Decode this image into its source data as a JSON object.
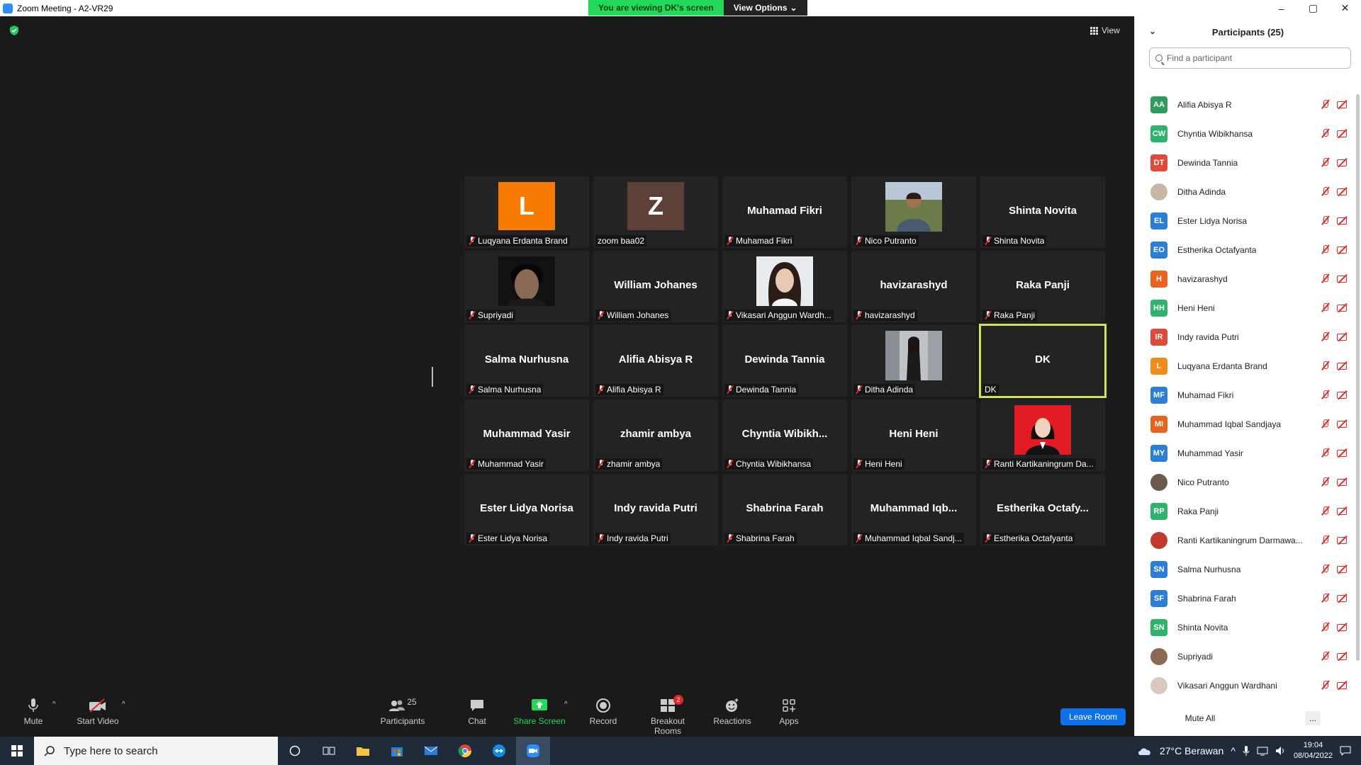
{
  "window": {
    "title": "Zoom Meeting - A2-VR29",
    "controls": [
      "–",
      "▢",
      "✕"
    ]
  },
  "banner": {
    "viewing": "You are viewing DK's screen",
    "view_options": "View Options"
  },
  "stage": {
    "view_label": "View"
  },
  "tiles": [
    {
      "big": "",
      "avatar_letter": "L",
      "avatar_color": "#f57c00",
      "label": "Luqyana Erdanta Brand",
      "muted": true
    },
    {
      "big": "",
      "avatar_letter": "Z",
      "avatar_color": "#5d4037",
      "label": "zoom baa02",
      "muted": false
    },
    {
      "big": "Muhamad Fikri",
      "label": "Muhamad Fikri",
      "muted": true
    },
    {
      "big": "",
      "photo": "man-in-shirt",
      "label": "Nico Putranto",
      "muted": true
    },
    {
      "big": "Shinta Novita",
      "label": "Shinta Novita",
      "muted": true
    },
    {
      "big": "",
      "photo": "man-portrait",
      "label": "Supriyadi",
      "muted": true
    },
    {
      "big": "William Johanes",
      "label": "William Johanes",
      "muted": true
    },
    {
      "big": "",
      "photo": "woman-selfie",
      "label": "Vikasari Anggun Wardh...",
      "muted": true
    },
    {
      "big": "havizarashyd",
      "label": "havizarashyd",
      "muted": true
    },
    {
      "big": "Raka Panji",
      "label": "Raka Panji",
      "muted": true
    },
    {
      "big": "Salma Nurhusna",
      "label": "Salma Nurhusna",
      "muted": true
    },
    {
      "big": "Alifia Abisya R",
      "label": "Alifia Abisya R",
      "muted": true
    },
    {
      "big": "Dewinda Tannia",
      "label": "Dewinda Tannia",
      "muted": true
    },
    {
      "big": "",
      "photo": "woman-standing",
      "label": "Ditha Adinda",
      "muted": true
    },
    {
      "big": "DK",
      "label": "DK",
      "muted": false,
      "active": true
    },
    {
      "big": "Muhammad Yasir",
      "label": "Muhammad Yasir",
      "muted": true
    },
    {
      "big": "zhamir ambya",
      "label": "zhamir ambya",
      "muted": true
    },
    {
      "big": "Chyntia  Wibikh...",
      "label": "Chyntia Wibikhansa",
      "muted": true
    },
    {
      "big": "Heni Heni",
      "label": "Heni Heni",
      "muted": true
    },
    {
      "big": "",
      "photo": "woman-red-bg",
      "label": "Ranti Kartikaningrum Da...",
      "muted": true
    },
    {
      "big": "Ester Lidya Norisa",
      "label": "Ester Lidya Norisa",
      "muted": true
    },
    {
      "big": "Indy ravida Putri",
      "label": "Indy ravida Putri",
      "muted": true
    },
    {
      "big": "Shabrina Farah",
      "label": "Shabrina Farah",
      "muted": true
    },
    {
      "big": "Muhammad  Iqb...",
      "label": "Muhammad Iqbal Sandj...",
      "muted": true
    },
    {
      "big": "Estherika  Octafy...",
      "label": "Estherika Octafyanta",
      "muted": true
    }
  ],
  "toolbar": {
    "mute": "Mute",
    "start_video": "Start Video",
    "participants": "Participants",
    "participants_count": "25",
    "chat": "Chat",
    "share_screen": "Share Screen",
    "record": "Record",
    "breakout_rooms": "Breakout Rooms",
    "breakout_badge": "2",
    "reactions": "Reactions",
    "apps": "Apps",
    "leave": "Leave Room"
  },
  "panel": {
    "title": "Participants (25)",
    "search_placeholder": "Find a participant",
    "mute_all": "Mute All",
    "more": "...",
    "participants": [
      {
        "initials": "AA",
        "color": "#2e9d5b",
        "name": "Alifia Abisya R"
      },
      {
        "initials": "CW",
        "color": "#2db36b",
        "name": "Chyntia Wibikhansa"
      },
      {
        "initials": "DT",
        "color": "#e04a3a",
        "name": "Dewinda Tannia"
      },
      {
        "initials": "",
        "color": "#c8b7a6",
        "name": "Ditha Adinda"
      },
      {
        "initials": "EL",
        "color": "#2b7ed6",
        "name": "Ester Lidya Norisa"
      },
      {
        "initials": "EO",
        "color": "#2b7ed6",
        "name": "Estherika Octafyanta"
      },
      {
        "initials": "H",
        "color": "#e8631b",
        "name": "havizarashyd"
      },
      {
        "initials": "HH",
        "color": "#2db36b",
        "name": "Heni Heni"
      },
      {
        "initials": "IR",
        "color": "#e04a3a",
        "name": "Indy ravida Putri"
      },
      {
        "initials": "L",
        "color": "#f08c1a",
        "name": "Luqyana Erdanta Brand"
      },
      {
        "initials": "MF",
        "color": "#2b7ed6",
        "name": "Muhamad Fikri"
      },
      {
        "initials": "MI",
        "color": "#e8631b",
        "name": "Muhammad Iqbal Sandjaya"
      },
      {
        "initials": "MY",
        "color": "#2b7ed6",
        "name": "Muhammad Yasir"
      },
      {
        "initials": "",
        "color": "#6b5a4a",
        "name": "Nico Putranto"
      },
      {
        "initials": "RP",
        "color": "#2db36b",
        "name": "Raka Panji"
      },
      {
        "initials": "",
        "color": "#c0392b",
        "name": "Ranti Kartikaningrum Darmawa..."
      },
      {
        "initials": "SN",
        "color": "#2b7ed6",
        "name": "Salma Nurhusna"
      },
      {
        "initials": "SF",
        "color": "#2b7ed6",
        "name": "Shabrina Farah"
      },
      {
        "initials": "SN",
        "color": "#2db36b",
        "name": "Shinta Novita"
      },
      {
        "initials": "",
        "color": "#8a6a55",
        "name": "Supriyadi"
      },
      {
        "initials": "",
        "color": "#d8c8c0",
        "name": "Vikasari Anggun Wardhani"
      }
    ]
  },
  "taskbar": {
    "search_placeholder": "Type here to search",
    "weather": "27°C  Berawan",
    "time": "19:04",
    "date": "08/04/2022"
  }
}
